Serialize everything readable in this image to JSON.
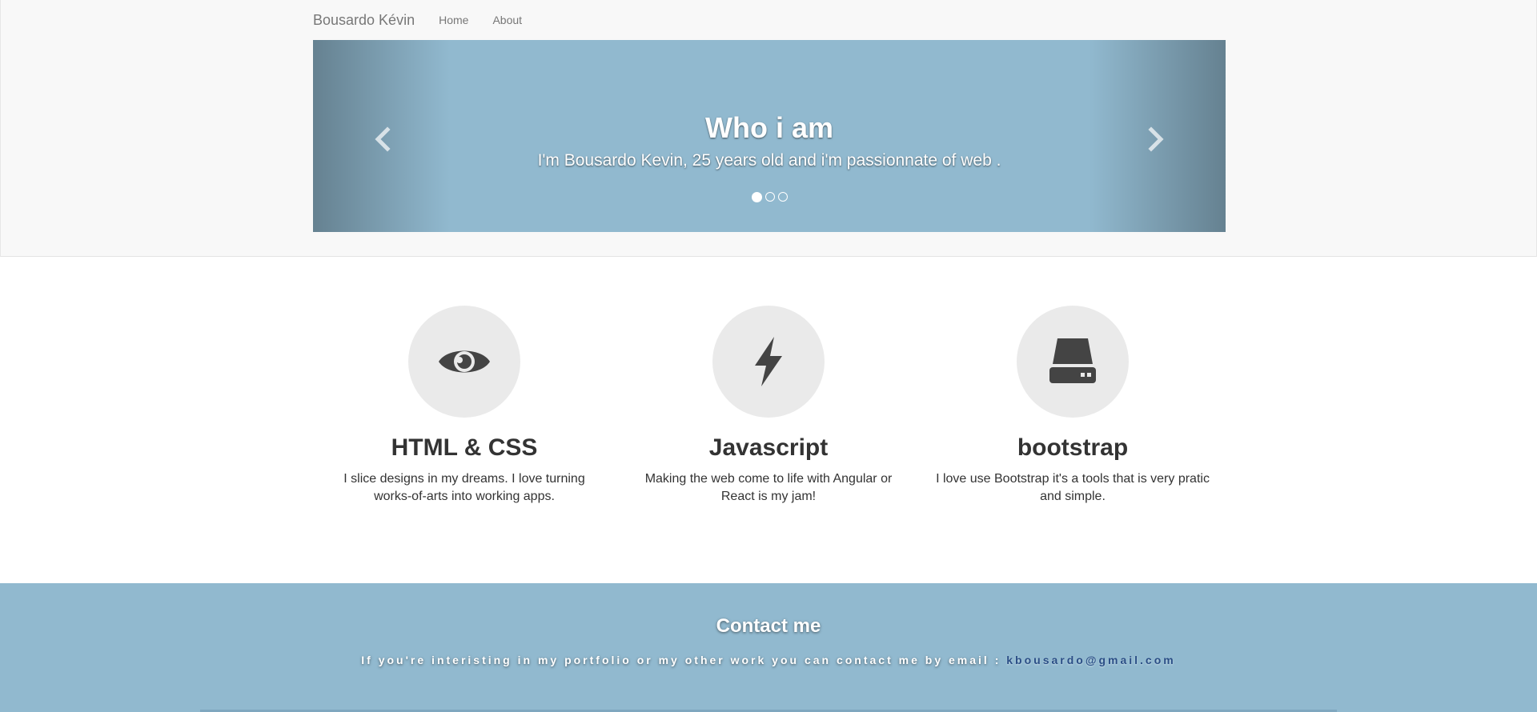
{
  "navbar": {
    "brand": "Bousardo Kévin",
    "links": [
      {
        "label": "Home"
      },
      {
        "label": "About"
      }
    ]
  },
  "carousel": {
    "title": "Who i am",
    "text": "I'm Bousardo Kevin, 25 years old and i'm passionnate of web .",
    "prev_icon": "chevron-left-icon",
    "next_icon": "chevron-right-icon",
    "slide_count": 3,
    "active_slide": 1,
    "background": "#91b9cf"
  },
  "features": [
    {
      "icon": "eye-icon",
      "title": "HTML & CSS",
      "text": "I slice designs in my dreams. I love turning works-of-arts into working apps."
    },
    {
      "icon": "lightning-bolt-icon",
      "title": "Javascript",
      "text": "Making the web come to life with Angular or React is my jam!"
    },
    {
      "icon": "hard-drive-icon",
      "title": "bootstrap",
      "text": "I love use Bootstrap it's a tools that is very pratic and simple."
    }
  ],
  "contact": {
    "title": "Contact me",
    "text": "If you're interisting in my portfolio or my other work you can contact me by email :",
    "email": "kbousardo@gmail.com",
    "background": "#91b9cf"
  },
  "colors": {
    "accent": "#91b9cf",
    "icon": "#444444",
    "circle": "#eaeaea",
    "link": "#2a4e86"
  }
}
